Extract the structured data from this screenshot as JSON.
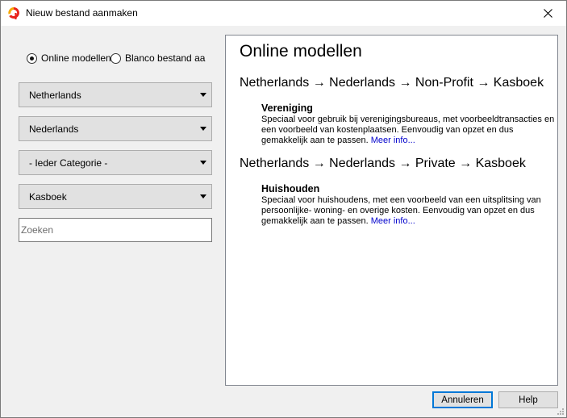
{
  "window": {
    "title": "Nieuw bestand aanmaken",
    "accent": "#0078d7"
  },
  "source": {
    "online_label": "Online modellen",
    "blank_label": "Blanco bestand aanmaken",
    "selected": "online"
  },
  "filters": {
    "country": "Netherlands",
    "language": "Nederlands",
    "category": "- Ieder Categorie -",
    "type": "Kasboek"
  },
  "search": {
    "placeholder": "Zoeken",
    "value": ""
  },
  "content": {
    "heading": "Online modellen",
    "groups": [
      {
        "path": "Netherlands → Nederlands → Non-Profit → Kasboek",
        "model": {
          "title": "Vereniging",
          "description": "Speciaal voor gebruik bij verenigingsbureaus, met voorbeeldtransacties en een voorbeeld van kostenplaatsen. Eenvoudig van opzet en dus gemakkelijk aan te passen.",
          "link": "Meer info..."
        }
      },
      {
        "path": "Netherlands → Nederlands → Private → Kasboek",
        "model": {
          "title": "Huishouden",
          "description": "Speciaal voor huishoudens, met een voorbeeld van een uitsplitsing van persoonlijke- woning- en overige kosten. Eenvoudig van opzet en dus gemakkelijk aan te passen.",
          "link": "Meer info..."
        }
      }
    ]
  },
  "buttons": {
    "cancel": "Annuleren",
    "help": "Help"
  },
  "icons": {
    "app": "app-logo-icon",
    "close": "close-icon",
    "dropdown": "chevron-down-icon",
    "grip": "resize-grip-icon"
  }
}
